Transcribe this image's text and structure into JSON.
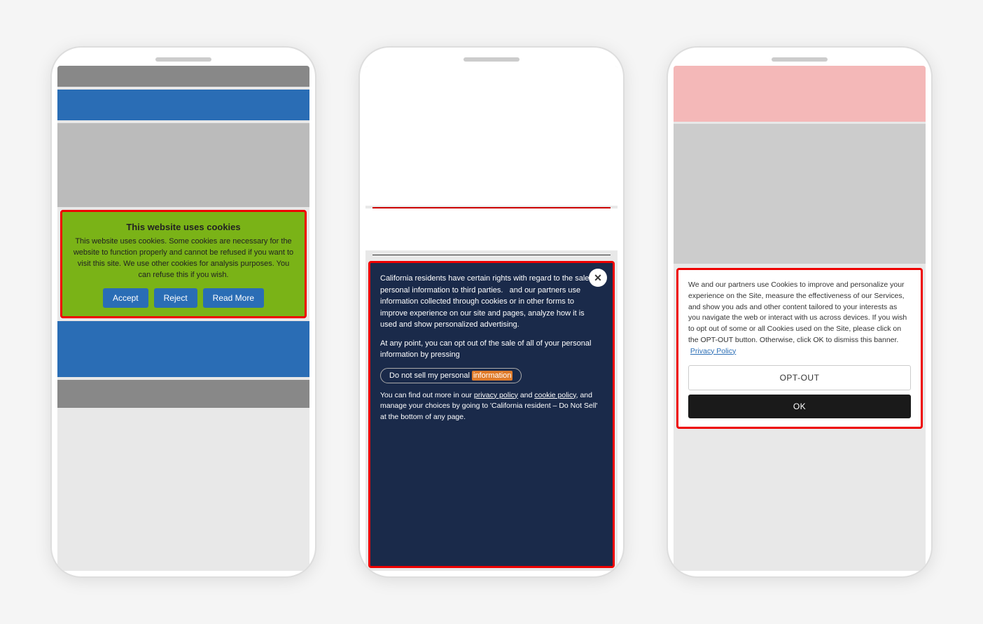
{
  "phone1": {
    "cookie_title": "This website uses cookies",
    "cookie_body": "This website uses cookies. Some cookies are necessary for the website to function properly and cannot be refused if you want to visit this site. We use other cookies for analysis purposes. You can refuse this if you wish.",
    "btn_accept": "Accept",
    "btn_reject": "Reject",
    "btn_read_more": "Read More"
  },
  "phone2": {
    "body_text1": "California residents have certain rights with regard to the sale of personal information to third parties.",
    "body_text1b": "and our partners use information collected through cookies or in other forms to improve experience on our site and pages, analyze how it is used and show personalized advertising.",
    "body_text2": "At any point, you can opt out of the sale of all of your personal information by pressing",
    "opt_out_label": "Do not sell my personal information",
    "footer_text1": "You can find out more in our ",
    "footer_link1": "privacy policy",
    "footer_text2": " and ",
    "footer_link2": "cookie policy",
    "footer_text3": ", and manage your choices by going to 'California resident – Do Not Sell' at the bottom of any page."
  },
  "phone3": {
    "body_text": "We and our partners use Cookies to improve and personalize your experience on the Site, measure the effectiveness of our Services, and show you ads and other content tailored to your interests as you navigate the web or interact with us across devices. If you wish to opt out of some or all Cookies used on the Site, please click on the OPT-OUT button. Otherwise, click OK to dismiss this banner.",
    "privacy_policy_link": "Privacy Policy",
    "btn_opt_out": "OPT-OUT",
    "btn_ok": "OK"
  }
}
